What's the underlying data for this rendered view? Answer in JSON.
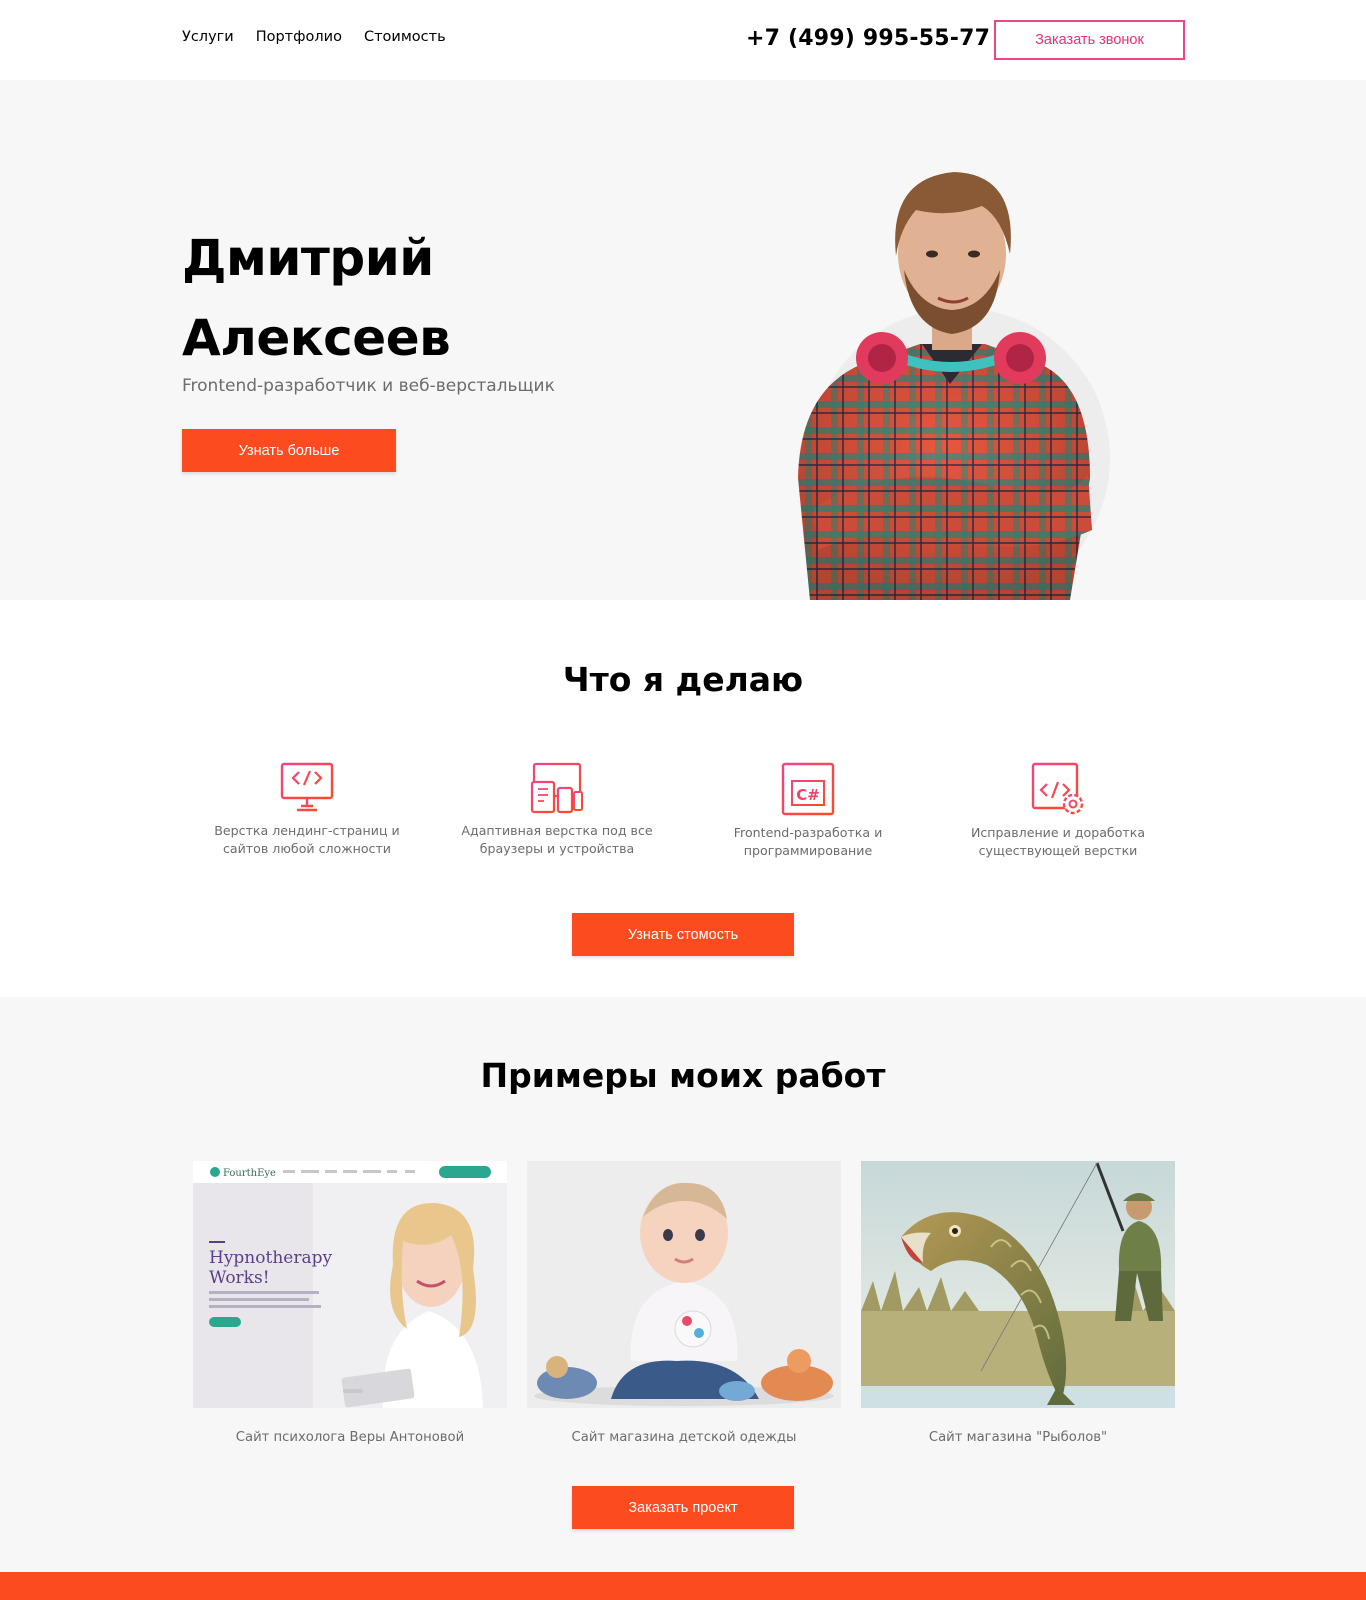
{
  "header": {
    "nav": [
      "Услуги",
      "Портфолио",
      "Стоимость"
    ],
    "phone": "+7 (499) 995-55-77",
    "callback_label": "Заказать звонок"
  },
  "hero": {
    "first_name": "Дмитрий",
    "last_name": "Алексеев",
    "subtitle": "Frontend-разработчик и веб-верстальщик",
    "button_label": "Узнать больше"
  },
  "services": {
    "title": "Что я делаю",
    "items": [
      {
        "icon": "monitor-code-icon",
        "line1": "Верстка лендинг-страниц и",
        "line2": "сайтов любой сложности"
      },
      {
        "icon": "responsive-devices-icon",
        "line1": "Адаптивная верстка под все",
        "line2": "браузеры и устройства"
      },
      {
        "icon": "csharp-window-icon",
        "line1": "Frontend-разработка и",
        "line2": "программирование"
      },
      {
        "icon": "code-settings-icon",
        "line1": "Исправление и доработка",
        "line2": "существующей верстки"
      }
    ],
    "button_label": "Узнать стомость"
  },
  "portfolio": {
    "title": "Примеры моих работ",
    "works": [
      {
        "caption": "Сайт психолога Веры Антоновой",
        "logo": "FourthEye",
        "headline1": "Hypnotherapy",
        "headline2": "Works!"
      },
      {
        "caption": "Сайт магазина детской одежды"
      },
      {
        "caption": "Сайт магазина \"Рыболов\""
      }
    ],
    "button_label": "Заказать проект"
  },
  "colors": {
    "accent": "#fd4b20",
    "pink": "#f0448a",
    "muted_text": "#6c6c6c",
    "section_bg": "#f7f7f7"
  }
}
